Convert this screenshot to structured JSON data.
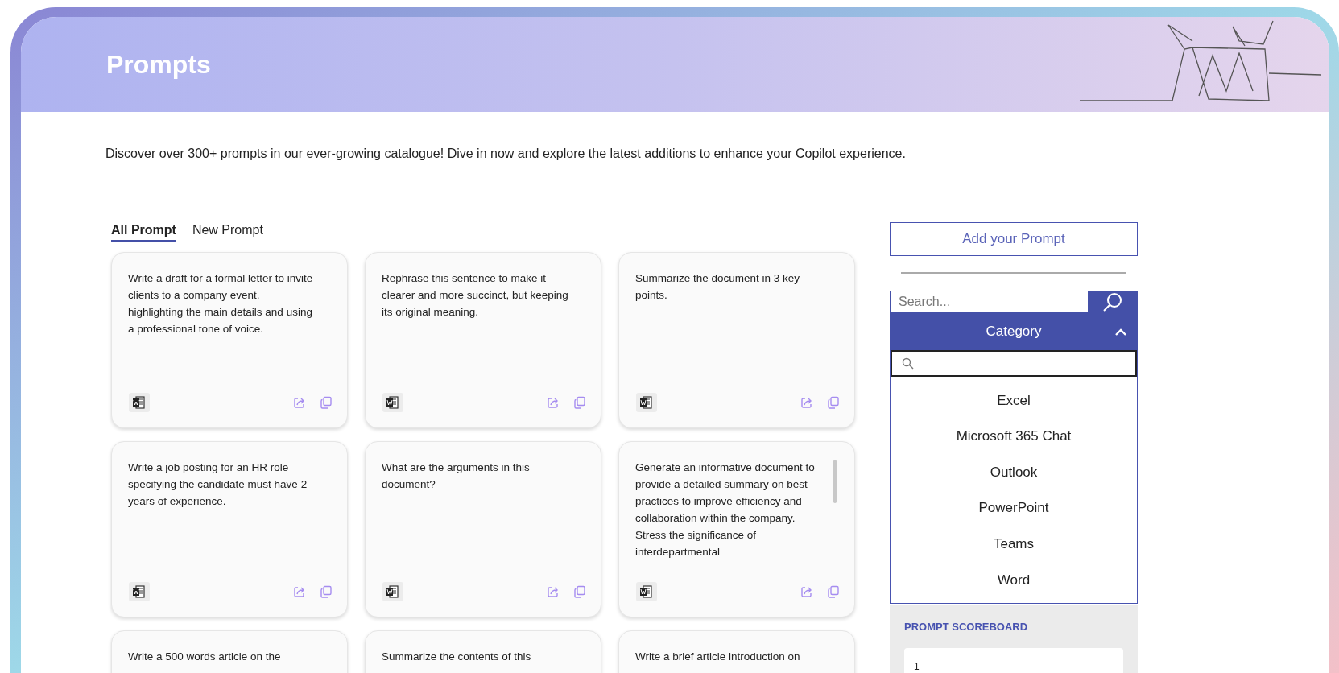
{
  "header": {
    "title": "Prompts"
  },
  "intro": "Discover over 300+ prompts in our ever-growing catalogue! Dive in now and explore the latest additions to enhance your Copilot experience.",
  "tabs": [
    {
      "label": "All Prompt",
      "selected": true
    },
    {
      "label": "New Prompt",
      "selected": false
    }
  ],
  "cards": [
    {
      "text": "Write a draft for a formal letter to invite clients to a company event, highlighting the main details and using a professional tone of voice.",
      "scrollable": false
    },
    {
      "text": "Rephrase this sentence to make it clearer and more succinct, but keeping its original meaning.",
      "scrollable": false
    },
    {
      "text": "Summarize the document in 3 key points.",
      "scrollable": false
    },
    {
      "text": "Write a job posting for an HR role specifying the candidate must have 2 years of experience.",
      "scrollable": false
    },
    {
      "text": "What are the arguments in this document?",
      "scrollable": false
    },
    {
      "text": "Generate an informative document to provide a detailed summary on best practices to improve efficiency and collaboration within the company. Stress the significance of interdepartmental",
      "scrollable": true
    },
    {
      "text": "Write a 500 words article on the",
      "scrollable": false
    },
    {
      "text": "Summarize the contents of this",
      "scrollable": false
    },
    {
      "text": "Write a brief article introduction on",
      "scrollable": false
    }
  ],
  "sidebar": {
    "add_button": "Add your Prompt",
    "search": {
      "placeholder": "Search..."
    },
    "category": {
      "label": "Category",
      "expanded": true,
      "items": [
        "Excel",
        "Microsoft 365 Chat",
        "Outlook",
        "PowerPoint",
        "Teams",
        "Word"
      ]
    },
    "scoreboard": {
      "title": "PROMPT SCOREBOARD",
      "entries": [
        "1"
      ]
    }
  }
}
